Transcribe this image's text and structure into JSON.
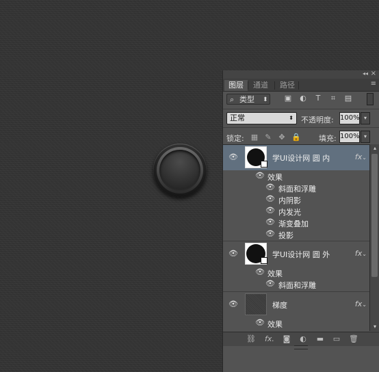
{
  "panel": {
    "collapse_glyph": "◂◂",
    "close_glyph": "×",
    "menu_glyph": "≡",
    "tabs": [
      {
        "label": "图层",
        "active": true
      },
      {
        "label": "通道",
        "active": false
      },
      {
        "label": "路径",
        "active": false
      }
    ]
  },
  "filter": {
    "search_glyph": "⌕",
    "kind_label": "类型",
    "arrow": "⬍",
    "icons": [
      "image-filter-icon",
      "adjustment-filter-icon",
      "type-filter-icon",
      "shape-filter-icon",
      "smart-object-filter-icon"
    ],
    "icon_glyphs": [
      "▣",
      "◐",
      "T",
      "⌗",
      "▤"
    ]
  },
  "blend": {
    "mode": "正常",
    "arrow": "⬍",
    "opacity_label": "不透明度:",
    "opacity_value": "100%",
    "dropdown_arrow": "▾"
  },
  "lock": {
    "label": "锁定:",
    "icons": [
      "lock-transparent-icon",
      "lock-paint-icon",
      "lock-position-icon",
      "lock-all-icon"
    ],
    "icon_glyphs": [
      "▦",
      "✎",
      "✥",
      "🔒"
    ],
    "fill_label": "填充:",
    "fill_value": "100%"
  },
  "layers": [
    {
      "name": "学UI设计网 圆 内",
      "selected": true,
      "fx": "fx",
      "effects_label": "效果",
      "effects": [
        "斜面和浮雕",
        "内阴影",
        "内发光",
        "渐变叠加",
        "投影"
      ]
    },
    {
      "name": "学UI设计网 圆 外",
      "selected": false,
      "fx": "fx",
      "effects_label": "效果",
      "effects": [
        "斜面和浮雕"
      ]
    },
    {
      "name": "梯度",
      "selected": false,
      "fx": "fx",
      "effects_label": "效果",
      "effects": []
    }
  ],
  "eye_glyph": "👁",
  "fx_chevron": "⌄",
  "scroll": {
    "up": "▴",
    "down": "▾"
  },
  "bottom": {
    "icons": [
      "link-layers-icon",
      "layer-style-icon",
      "add-mask-icon",
      "adjustment-layer-icon",
      "new-group-icon",
      "new-layer-icon",
      "delete-layer-icon"
    ],
    "glyphs": [
      "⛓",
      "fx.",
      "◙",
      "◐",
      "▬",
      "▭",
      "🗑"
    ]
  }
}
